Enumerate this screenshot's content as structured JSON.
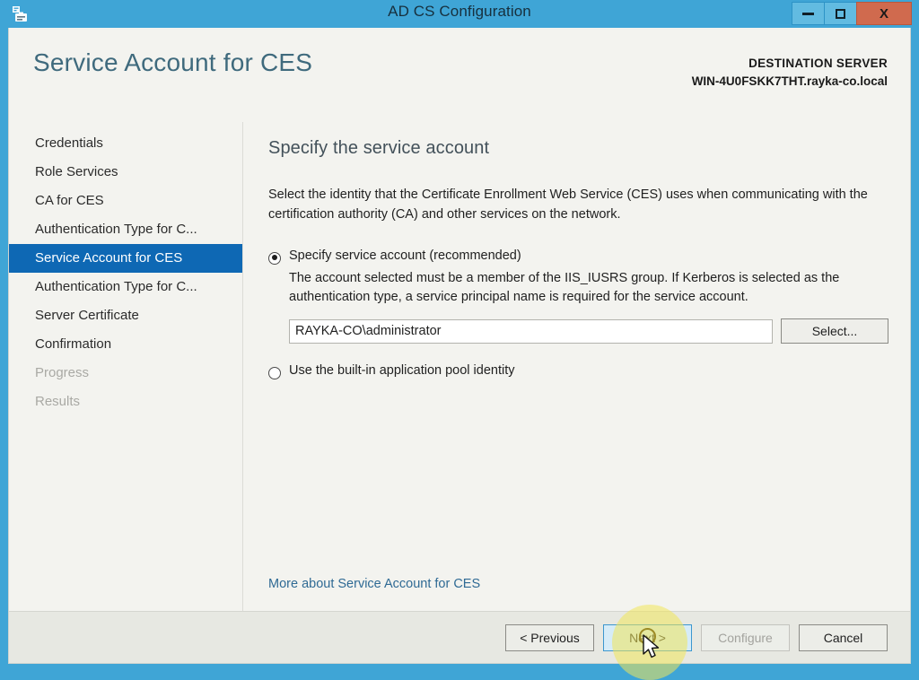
{
  "window": {
    "title": "AD CS Configuration",
    "icon": "certificate-services-icon",
    "controls": {
      "minimize": "minimize-icon",
      "maximize": "maximize-icon",
      "close": "X"
    }
  },
  "header": {
    "page_title": "Service Account for CES",
    "destination_label": "DESTINATION SERVER",
    "destination_server": "WIN-4U0FSKK7THT.rayka-co.local"
  },
  "sidebar": {
    "items": [
      {
        "label": "Credentials",
        "state": "normal"
      },
      {
        "label": "Role Services",
        "state": "normal"
      },
      {
        "label": "CA for CES",
        "state": "normal"
      },
      {
        "label": "Authentication Type for C...",
        "state": "normal"
      },
      {
        "label": "Service Account for CES",
        "state": "selected"
      },
      {
        "label": "Authentication Type for C...",
        "state": "normal"
      },
      {
        "label": "Server Certificate",
        "state": "normal"
      },
      {
        "label": "Confirmation",
        "state": "normal"
      },
      {
        "label": "Progress",
        "state": "disabled"
      },
      {
        "label": "Results",
        "state": "disabled"
      }
    ]
  },
  "content": {
    "heading": "Specify the service account",
    "description": "Select the identity that the Certificate Enrollment Web Service (CES) uses when communicating with the certification authority (CA) and other services on the network.",
    "option_specify": {
      "label": "Specify service account (recommended)",
      "help": "The account selected must be a member of the IIS_IUSRS group. If Kerberos is selected as the authentication type, a service principal name is required for the service account.",
      "checked": true,
      "account_value": "RAYKA-CO\\administrator",
      "account_placeholder": "",
      "select_button": "Select..."
    },
    "option_builtin": {
      "label": "Use the built-in application pool identity",
      "checked": false
    },
    "more_link": "More about Service Account for CES"
  },
  "footer": {
    "previous": "< Previous",
    "next": "Next >",
    "configure": "Configure",
    "cancel": "Cancel"
  },
  "colors": {
    "titlebar": "#3fa5d6",
    "accent_selected": "#0e68b4",
    "close_button": "#d06a4e",
    "link": "#2f6a94",
    "page_title": "#3f6a7d",
    "cursor_highlight": "#f0e65a"
  }
}
